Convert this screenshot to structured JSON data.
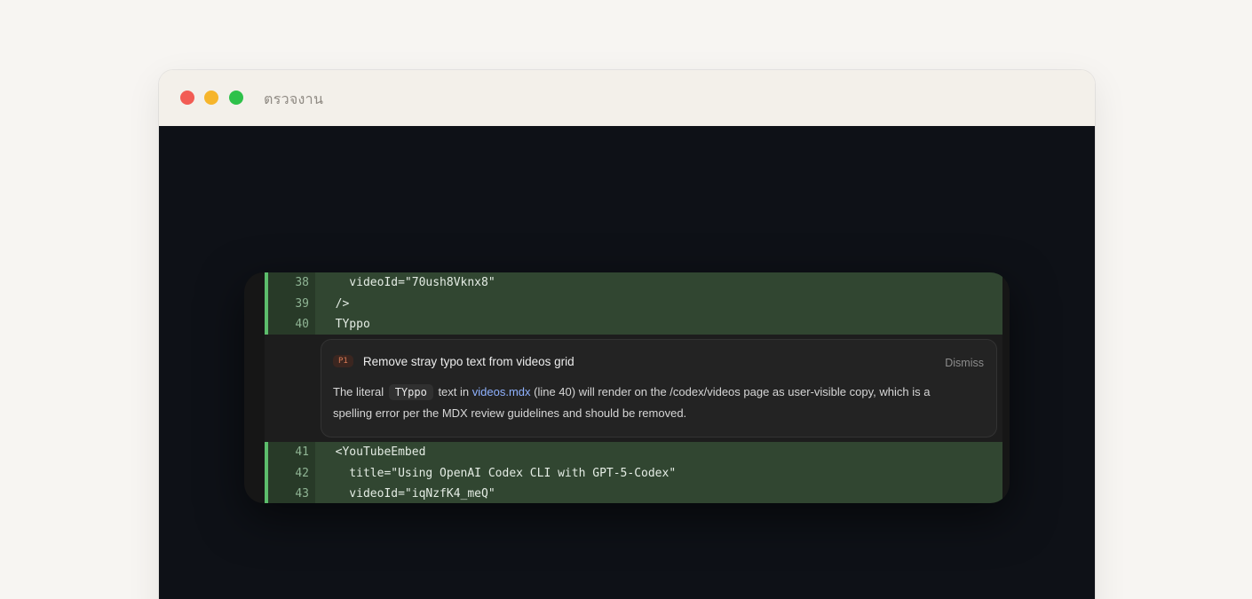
{
  "window": {
    "title": "ตรวจงาน",
    "controls": [
      "close",
      "minimize",
      "zoom"
    ]
  },
  "diff_top": [
    {
      "num": "38",
      "code": "    videoId=\"70ush8Vknx8\""
    },
    {
      "num": "39",
      "code": "  />"
    },
    {
      "num": "40",
      "code": "  TYppo"
    }
  ],
  "review_comment": {
    "priority": "P1",
    "title": "Remove stray typo text from videos grid",
    "dismiss_label": "Dismiss",
    "body": {
      "part1": "The literal ",
      "code": "TYppo",
      "part2": " text in ",
      "file": "videos.mdx",
      "part3": " (line 40) will render on the /codex/videos page as user-visible copy, which is a spelling error per the MDX review guidelines and should be removed."
    }
  },
  "diff_bottom": [
    {
      "num": "41",
      "code": "  <YouTubeEmbed"
    },
    {
      "num": "42",
      "code": "    title=\"Using OpenAI Codex CLI with GPT-5-Codex\""
    },
    {
      "num": "43",
      "code": "    videoId=\"iqNzfK4_meQ\""
    }
  ],
  "colors": {
    "added_line_bg": "#314631",
    "added_line_border": "#5cbd6c",
    "canvas_bg": "#0e1117",
    "link": "#8fb2ff",
    "priority_badge": "#d97a55"
  }
}
